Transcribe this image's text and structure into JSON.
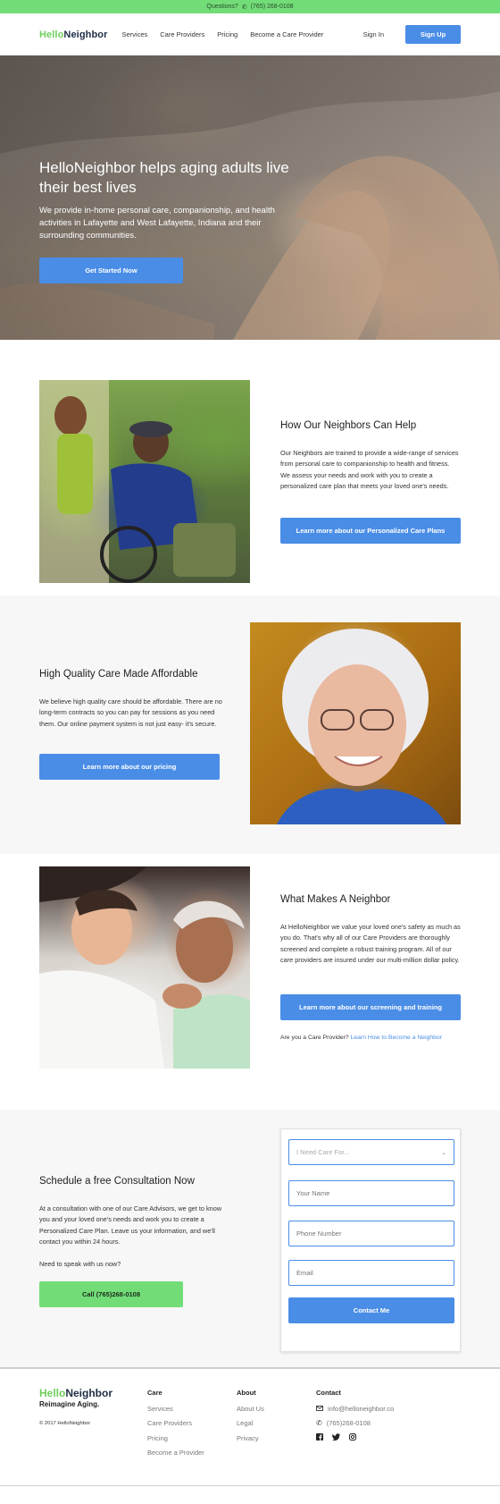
{
  "topbar": {
    "question": "Questions?",
    "phone": "(765) 268-0108"
  },
  "nav": {
    "logo_hello": "Hello",
    "logo_neighbor": "Neighbor",
    "links": [
      "Services",
      "Care Providers",
      "Pricing",
      "Become a Care Provider"
    ],
    "signin": "Sign In",
    "signup": "Sign Up"
  },
  "hero": {
    "title": "HelloNeighbor helps aging adults live their best lives",
    "subtitle": "We provide in-home personal care, companionship, and health activities in Lafayette and West Lafayette, Indiana and their surrounding communities.",
    "cta": "Get Started Now"
  },
  "help": {
    "title": "How Our Neighbors Can Help",
    "body": "Our Neighbors are trained to provide a wide-range of services from personal care to companionship to health and fitness. We assess your needs and work with you to create a personalized care plan that meets your loved one's needs.",
    "cta": "Learn more about our Personalized Care Plans"
  },
  "affordable": {
    "title": "High Quality Care Made Affordable",
    "body": "We believe high quality care should be affordable. There are no long-term contracts so you can pay for sessions as you need them. Our online payment system is not just easy- it's secure.",
    "cta": "Learn more about our pricing"
  },
  "neighbor": {
    "title": "What Makes A Neighbor",
    "body": "At HelloNeighbor we value your loved one's safety as much as you do. That's why all of our Care Providers are thoroughly screened and complete a robust training program. All of our care providers are insured under our multi-million dollar policy.",
    "cta": "Learn more about our screening and training",
    "provider_question": "Are you a Care Provider?",
    "provider_link": "Learn How to Become a Neighbor"
  },
  "consult": {
    "title": "Schedule a free Consultation Now",
    "body": "At a consultation with one of our Care Advisors, we get to know you and your loved one's needs and work you to create a Personalized Care Plan. Leave us your information, and we'll contact you within 24 hours.",
    "speak": "Need to speak with us now?",
    "call_cta": "Call (765)268-0108",
    "form": {
      "care_for_placeholder": "I Need Care For...",
      "name_placeholder": "Your Name",
      "phone_placeholder": "Phone Number",
      "email_placeholder": "Email",
      "submit": "Contact Me"
    }
  },
  "footer": {
    "logo_hello": "Hello",
    "logo_neighbor": "Neighbor",
    "tagline": "Reimagine Aging.",
    "copyright": "© 2017 HelloNeighbor",
    "care": {
      "title": "Care",
      "items": [
        "Services",
        "Care Providers",
        "Pricing",
        "Become a Provider"
      ]
    },
    "about": {
      "title": "About",
      "items": [
        "About Us",
        "Legal",
        "Privacy"
      ]
    },
    "contact": {
      "title": "Contact",
      "email": "info@helloneighbor.co",
      "phone": "(765)268-0108"
    }
  },
  "colors": {
    "green": "#72dd77",
    "blue": "#4a8de6",
    "logo_green": "#6fcf5c",
    "navy": "#1e2d44"
  },
  "icons": [
    "phone-icon",
    "chevron-down-icon",
    "mail-icon",
    "facebook-icon",
    "twitter-icon",
    "instagram-icon"
  ]
}
